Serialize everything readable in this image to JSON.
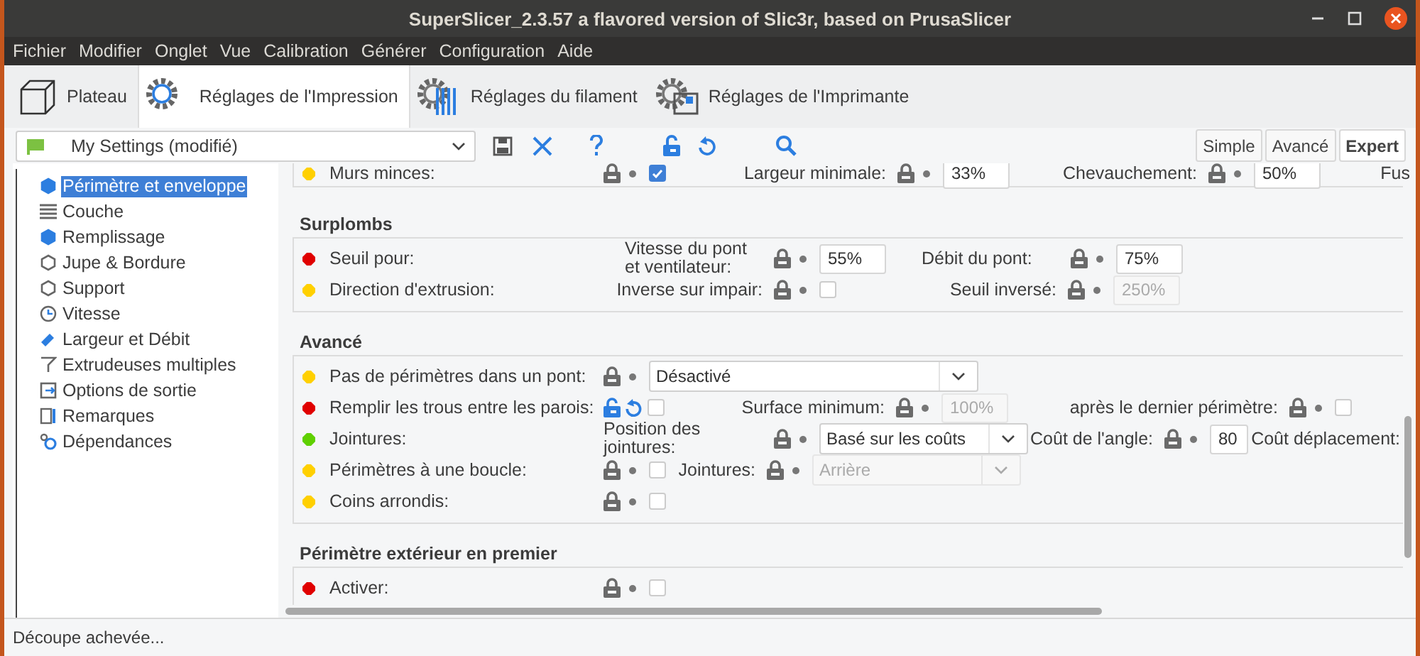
{
  "window": {
    "title": "SuperSlicer_2.3.57 a flavored version of Slic3r, based on PrusaSlicer"
  },
  "menu": [
    "Fichier",
    "Modifier",
    "Onglet",
    "Vue",
    "Calibration",
    "Générer",
    "Configuration",
    "Aide"
  ],
  "tabs": [
    {
      "label": "Plateau",
      "selected": false
    },
    {
      "label": "Réglages de l'Impression",
      "selected": true
    },
    {
      "label": "Réglages du filament",
      "selected": false
    },
    {
      "label": "Réglages de l'Imprimante",
      "selected": false
    }
  ],
  "preset": {
    "value": "My Settings (modifié)"
  },
  "modes": [
    {
      "label": "Simple",
      "selected": false
    },
    {
      "label": "Avancé",
      "selected": false
    },
    {
      "label": "Expert",
      "selected": true
    }
  ],
  "sidebar": {
    "items": [
      {
        "label": "Périmètre et enveloppe",
        "selected": true
      },
      {
        "label": "Couche",
        "selected": false
      },
      {
        "label": "Remplissage",
        "selected": false
      },
      {
        "label": "Jupe & Bordure",
        "selected": false
      },
      {
        "label": "Support",
        "selected": false
      },
      {
        "label": "Vitesse",
        "selected": false
      },
      {
        "label": "Largeur et Débit",
        "selected": false
      },
      {
        "label": "Extrudeuses multiples",
        "selected": false
      },
      {
        "label": "Options de sortie",
        "selected": false
      },
      {
        "label": "Remarques",
        "selected": false
      },
      {
        "label": "Dépendances",
        "selected": false
      }
    ]
  },
  "sections": [
    {
      "rows": [
        {
          "label": "Murs minces:",
          "color": "#ffd000",
          "options": [
            {
              "locked": true,
              "widget": {
                "kind": "checkbox",
                "checked": true
              }
            },
            {
              "label": "Largeur minimale:",
              "locked": true,
              "widget": {
                "kind": "field",
                "value": "33%",
                "disabled": false
              }
            },
            {
              "label": "Chevauchement:",
              "locked": true,
              "widget": {
                "kind": "field",
                "value": "50%",
                "disabled": false
              }
            },
            {
              "label": "Fus"
            }
          ]
        }
      ]
    },
    {
      "title": "Surplombs",
      "rows": [
        {
          "label": "Seuil pour:",
          "color": "#e00000",
          "options": [
            {
              "label": "Vitesse du pont et ventilateur:",
              "locked": true,
              "widget": {
                "kind": "field",
                "value": "55%",
                "disabled": false
              }
            },
            {
              "label": "Débit du pont:",
              "locked": true,
              "widget": {
                "kind": "field",
                "value": "75%",
                "disabled": false
              }
            }
          ]
        },
        {
          "label": "Direction d'extrusion:",
          "color": "#ffd000",
          "options": [
            {
              "label": "Inverse sur impair:",
              "locked": true,
              "widget": {
                "kind": "checkbox",
                "checked": false
              }
            },
            {
              "label": "Seuil inversé:",
              "locked": true,
              "widget": {
                "kind": "field",
                "value": "250%",
                "disabled": true
              }
            }
          ]
        }
      ]
    },
    {
      "title": "Avancé",
      "rows": [
        {
          "label": "Pas de périmètres dans un pont:",
          "color": "#ffd000",
          "options": [
            {
              "locked": true,
              "widget": {
                "kind": "select",
                "value": "Désactivé",
                "disabled": false
              }
            }
          ]
        },
        {
          "label": "Remplir les trous entre les parois:",
          "color": "#e00000",
          "options": [
            {
              "locked": false,
              "widget": {
                "kind": "checkbox",
                "checked": false
              }
            },
            {
              "label": "Surface minimum:",
              "locked": true,
              "widget": {
                "kind": "field",
                "value": "100%",
                "disabled": true
              }
            },
            {
              "label": "après le dernier périmètre:",
              "locked": true,
              "widget": {
                "kind": "checkbox",
                "checked": false
              }
            }
          ]
        },
        {
          "label": "Jointures:",
          "color": "#5fd000",
          "options": [
            {
              "label": "Position des jointures:",
              "locked": true,
              "widget": {
                "kind": "select",
                "value": "Basé sur les coûts",
                "disabled": false
              }
            },
            {
              "label": "Coût de l'angle:",
              "locked": true,
              "widget": {
                "kind": "field",
                "value": "80",
                "disabled": false
              }
            },
            {
              "label": "Coût déplacement:"
            }
          ]
        },
        {
          "label": "Périmètres à une boucle:",
          "color": "#ffd000",
          "options": [
            {
              "locked": true,
              "widget": {
                "kind": "checkbox",
                "checked": false
              }
            },
            {
              "label": "Jointures:",
              "locked": true,
              "widget": {
                "kind": "select",
                "value": "Arrière",
                "disabled": true
              }
            }
          ]
        },
        {
          "label": "Coins arrondis:",
          "color": "#ffd000",
          "options": [
            {
              "locked": true,
              "widget": {
                "kind": "checkbox",
                "checked": false
              }
            }
          ]
        }
      ]
    },
    {
      "title": "Périmètre extérieur en premier",
      "rows": [
        {
          "label": "Activer:",
          "color": "#e00000",
          "options": [
            {
              "locked": true,
              "widget": {
                "kind": "checkbox",
                "checked": false
              }
            }
          ]
        }
      ]
    }
  ],
  "status_bar": "Découpe achevée..."
}
